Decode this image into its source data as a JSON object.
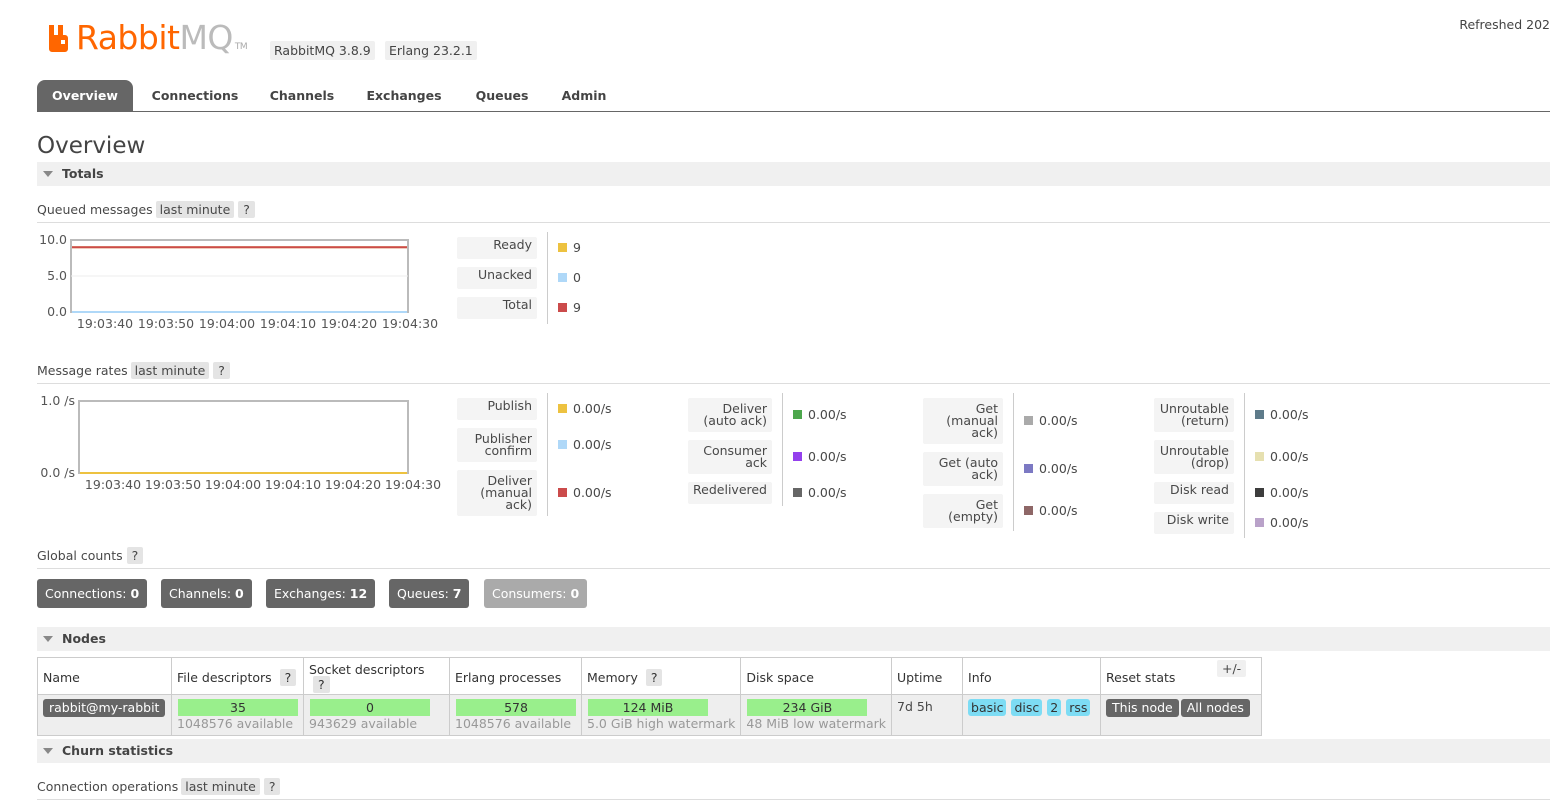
{
  "header": {
    "logo_rabbit": "Rabbit",
    "logo_mq": "MQ",
    "logo_tm": "TM",
    "rabbit_version": "RabbitMQ 3.8.9",
    "erlang_version": "Erlang 23.2.1",
    "refreshed": "Refreshed 202"
  },
  "tabs": [
    "Overview",
    "Connections",
    "Channels",
    "Exchanges",
    "Queues",
    "Admin"
  ],
  "page_title": "Overview",
  "totals": {
    "section_label": "Totals",
    "queued_messages_label": "Queued messages",
    "queued_range": "last minute",
    "help": "?",
    "message_rates_label": "Message rates",
    "rates_range": "last minute"
  },
  "queued_legend": [
    {
      "label": "Ready",
      "value": "9",
      "color": "#edc240"
    },
    {
      "label": "Unacked",
      "value": "0",
      "color": "#afd8f8"
    },
    {
      "label": "Total",
      "value": "9",
      "color": "#cb4b4b"
    }
  ],
  "rates_legend": {
    "col1": [
      {
        "label": "Publish",
        "value": "0.00/s",
        "color": "#edc240"
      },
      {
        "label": "Publisher confirm",
        "value": "0.00/s",
        "color": "#afd8f8"
      },
      {
        "label": "Deliver (manual ack)",
        "value": "0.00/s",
        "color": "#cb4b4b"
      }
    ],
    "col2": [
      {
        "label": "Deliver (auto ack)",
        "value": "0.00/s",
        "color": "#4da74d"
      },
      {
        "label": "Consumer ack",
        "value": "0.00/s",
        "color": "#9440ed"
      },
      {
        "label": "Redelivered",
        "value": "0.00/s",
        "color": "#666666"
      }
    ],
    "col3": [
      {
        "label": "Get (manual ack)",
        "value": "0.00/s",
        "color": "#aaaaaa"
      },
      {
        "label": "Get (auto ack)",
        "value": "0.00/s",
        "color": "#7c79c3"
      },
      {
        "label": "Get (empty)",
        "value": "0.00/s",
        "color": "#8e6767"
      }
    ],
    "col4": [
      {
        "label": "Unroutable (return)",
        "value": "0.00/s",
        "color": "#5e7b8a"
      },
      {
        "label": "Unroutable (drop)",
        "value": "0.00/s",
        "color": "#e6e0b0"
      },
      {
        "label": "Disk read",
        "value": "0.00/s",
        "color": "#3d3d3d"
      },
      {
        "label": "Disk write",
        "value": "0.00/s",
        "color": "#b9a2c9"
      }
    ]
  },
  "chart_data": [
    {
      "type": "line",
      "title": "Queued messages",
      "x": [
        "19:03:40",
        "19:03:50",
        "19:04:00",
        "19:04:10",
        "19:04:20",
        "19:04:30"
      ],
      "ylim": [
        0,
        10
      ],
      "yticks": [
        "10.0",
        "5.0",
        "0.0"
      ],
      "series": [
        {
          "name": "Ready",
          "values": [
            9,
            9,
            9,
            9,
            9,
            9
          ],
          "color": "#edc240"
        },
        {
          "name": "Unacked",
          "values": [
            0,
            0,
            0,
            0,
            0,
            0
          ],
          "color": "#afd8f8"
        },
        {
          "name": "Total",
          "values": [
            9,
            9,
            9,
            9,
            9,
            9
          ],
          "color": "#cb4b4b"
        }
      ]
    },
    {
      "type": "line",
      "title": "Message rates",
      "x": [
        "19:03:40",
        "19:03:50",
        "19:04:00",
        "19:04:10",
        "19:04:20",
        "19:04:30"
      ],
      "ylim": [
        0,
        1
      ],
      "yticks": [
        "1.0 /s",
        "0.0 /s"
      ],
      "series": [
        {
          "name": "Publish",
          "values": [
            0,
            0,
            0,
            0,
            0,
            0
          ],
          "color": "#edc240"
        }
      ]
    }
  ],
  "global_counts": {
    "label": "Global counts",
    "items": [
      {
        "label": "Connections:",
        "value": "0"
      },
      {
        "label": "Channels:",
        "value": "0"
      },
      {
        "label": "Exchanges:",
        "value": "12"
      },
      {
        "label": "Queues:",
        "value": "7"
      },
      {
        "label": "Consumers:",
        "value": "0"
      }
    ]
  },
  "nodes": {
    "section_label": "Nodes",
    "columns": [
      "Name",
      "File descriptors",
      "Socket descriptors",
      "Erlang processes",
      "Memory",
      "Disk space",
      "Uptime",
      "Info",
      "Reset stats"
    ],
    "plus_minus": "+/-",
    "row": {
      "name": "rabbit@my-rabbit",
      "fd": "35",
      "fd_sub": "1048576 available",
      "sd": "0",
      "sd_sub": "943629 available",
      "ep": "578",
      "ep_sub": "1048576 available",
      "mem": "124 MiB",
      "mem_sub": "5.0 GiB high watermark",
      "disk": "234 GiB",
      "disk_sub": "48 MiB low watermark",
      "uptime": "7d 5h",
      "info": [
        "basic",
        "disc",
        "2",
        "rss"
      ],
      "reset_this": "This node",
      "reset_all": "All nodes"
    }
  },
  "churn": {
    "section_label": "Churn statistics",
    "conn_ops_label": "Connection operations",
    "range": "last minute"
  }
}
